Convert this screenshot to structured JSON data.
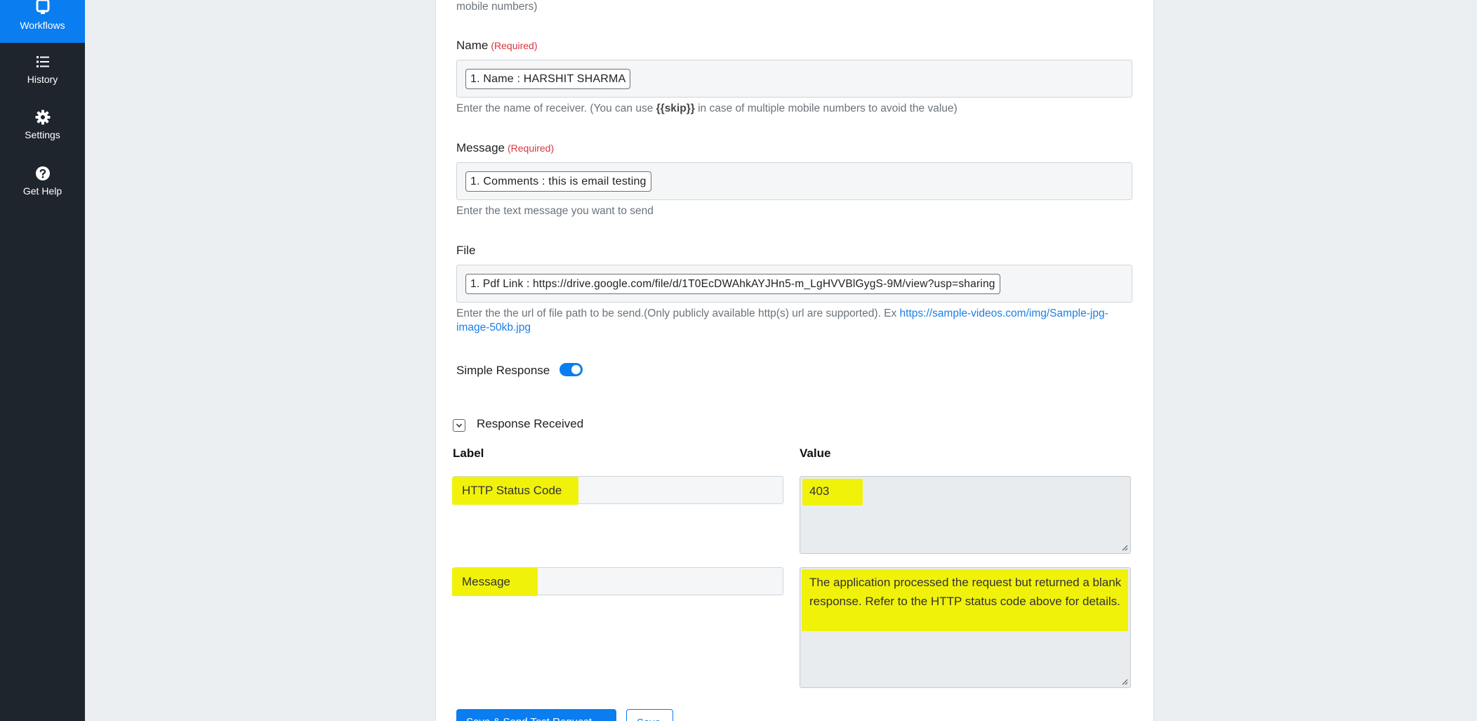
{
  "sidebar": {
    "items": [
      {
        "label": "Workflows",
        "icon": "workflows-icon",
        "active": true
      },
      {
        "label": "History",
        "icon": "history-list-icon",
        "active": false
      },
      {
        "label": "Settings",
        "icon": "gear-icon",
        "active": false
      },
      {
        "label": "Get Help",
        "icon": "help-circle-icon",
        "active": false
      }
    ]
  },
  "form": {
    "top_help_tail": "mobile numbers)",
    "name": {
      "label": "Name",
      "required": "(Required)",
      "chip": "1. Name : HARSHIT SHARMA",
      "help_before": "Enter the name of receiver. (You can use ",
      "help_bold": "{{skip}}",
      "help_after": " in case of multiple mobile numbers to avoid the value)"
    },
    "message": {
      "label": "Message",
      "required": "(Required)",
      "chip": "1. Comments : this is email testing",
      "help": "Enter the text message you want to send"
    },
    "file": {
      "label": "File",
      "chip": "1. Pdf Link : https://drive.google.com/file/d/1T0EcDWAhkAYJHn5-m_LgHVVBlGygS-9M/view?usp=sharing",
      "help": "Enter the the url of file path to be send.(Only publicly available http(s) url are supported). Ex ",
      "help_link": "https://sample-videos.com/img/Sample-jpg-image-50kb.jpg"
    },
    "simple_response": {
      "label": "Simple Response",
      "enabled": true
    }
  },
  "response": {
    "title": "Response Received",
    "label_header": "Label",
    "value_header": "Value",
    "rows": [
      {
        "label": "HTTP Status Code",
        "value": "403"
      },
      {
        "label": "Message",
        "value": "The application processed the request but returned a blank response.  Refer to the HTTP status code above for details."
      }
    ]
  },
  "buttons": {
    "primary": "Save & Send Test Request",
    "secondary": "Save"
  },
  "colors": {
    "accent": "#0a7df0",
    "sidebar": "#1f252c",
    "highlight": "#f1f20a",
    "required": "#d9343f"
  }
}
